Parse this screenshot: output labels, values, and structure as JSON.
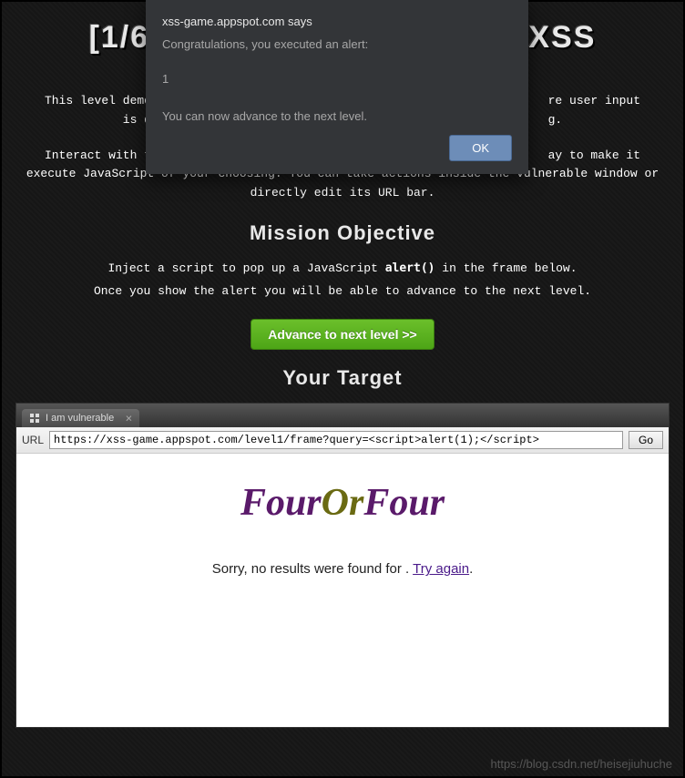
{
  "banner": {
    "level_indicator": "[1/6]",
    "suffix": "XSS"
  },
  "description": {
    "para1_prefix": "This level demo",
    "para1_suffix": "re user input",
    "para2_prefix": "is d",
    "para2_suffix": "g.",
    "para3_prefix": "Interact with t",
    "para3_suffix": "ay to make it",
    "para4": "execute JavaScript of your choosing. You can take actions inside the vulnerable window or directly edit its URL bar."
  },
  "mission": {
    "title": "Mission Objective",
    "line1_a": "Inject a script to pop up a JavaScript ",
    "line1_b": "alert()",
    "line1_c": " in the frame below.",
    "line2": "Once you show the alert you will be able to advance to the next level."
  },
  "advance_button": "Advance to next level >>",
  "target": {
    "title": "Your Target",
    "tab_title": "I am vulnerable",
    "url_label": "URL",
    "url_value": "https://xss-game.appspot.com/level1/frame?query=<script>alert(1);</script>",
    "go_label": "Go",
    "heading_parts": {
      "a": "Four",
      "b": "Or",
      "c": "Four"
    },
    "msg_prefix": "Sorry, no results were found for . ",
    "try_again": "Try again",
    "msg_suffix": "."
  },
  "dialog": {
    "origin": "xss-game.appspot.com says",
    "line1": "Congratulations, you executed an alert:",
    "value": "1",
    "line2": "You can now advance to the next level.",
    "ok": "OK"
  },
  "watermark": "https://blog.csdn.net/heisejiuhuche"
}
